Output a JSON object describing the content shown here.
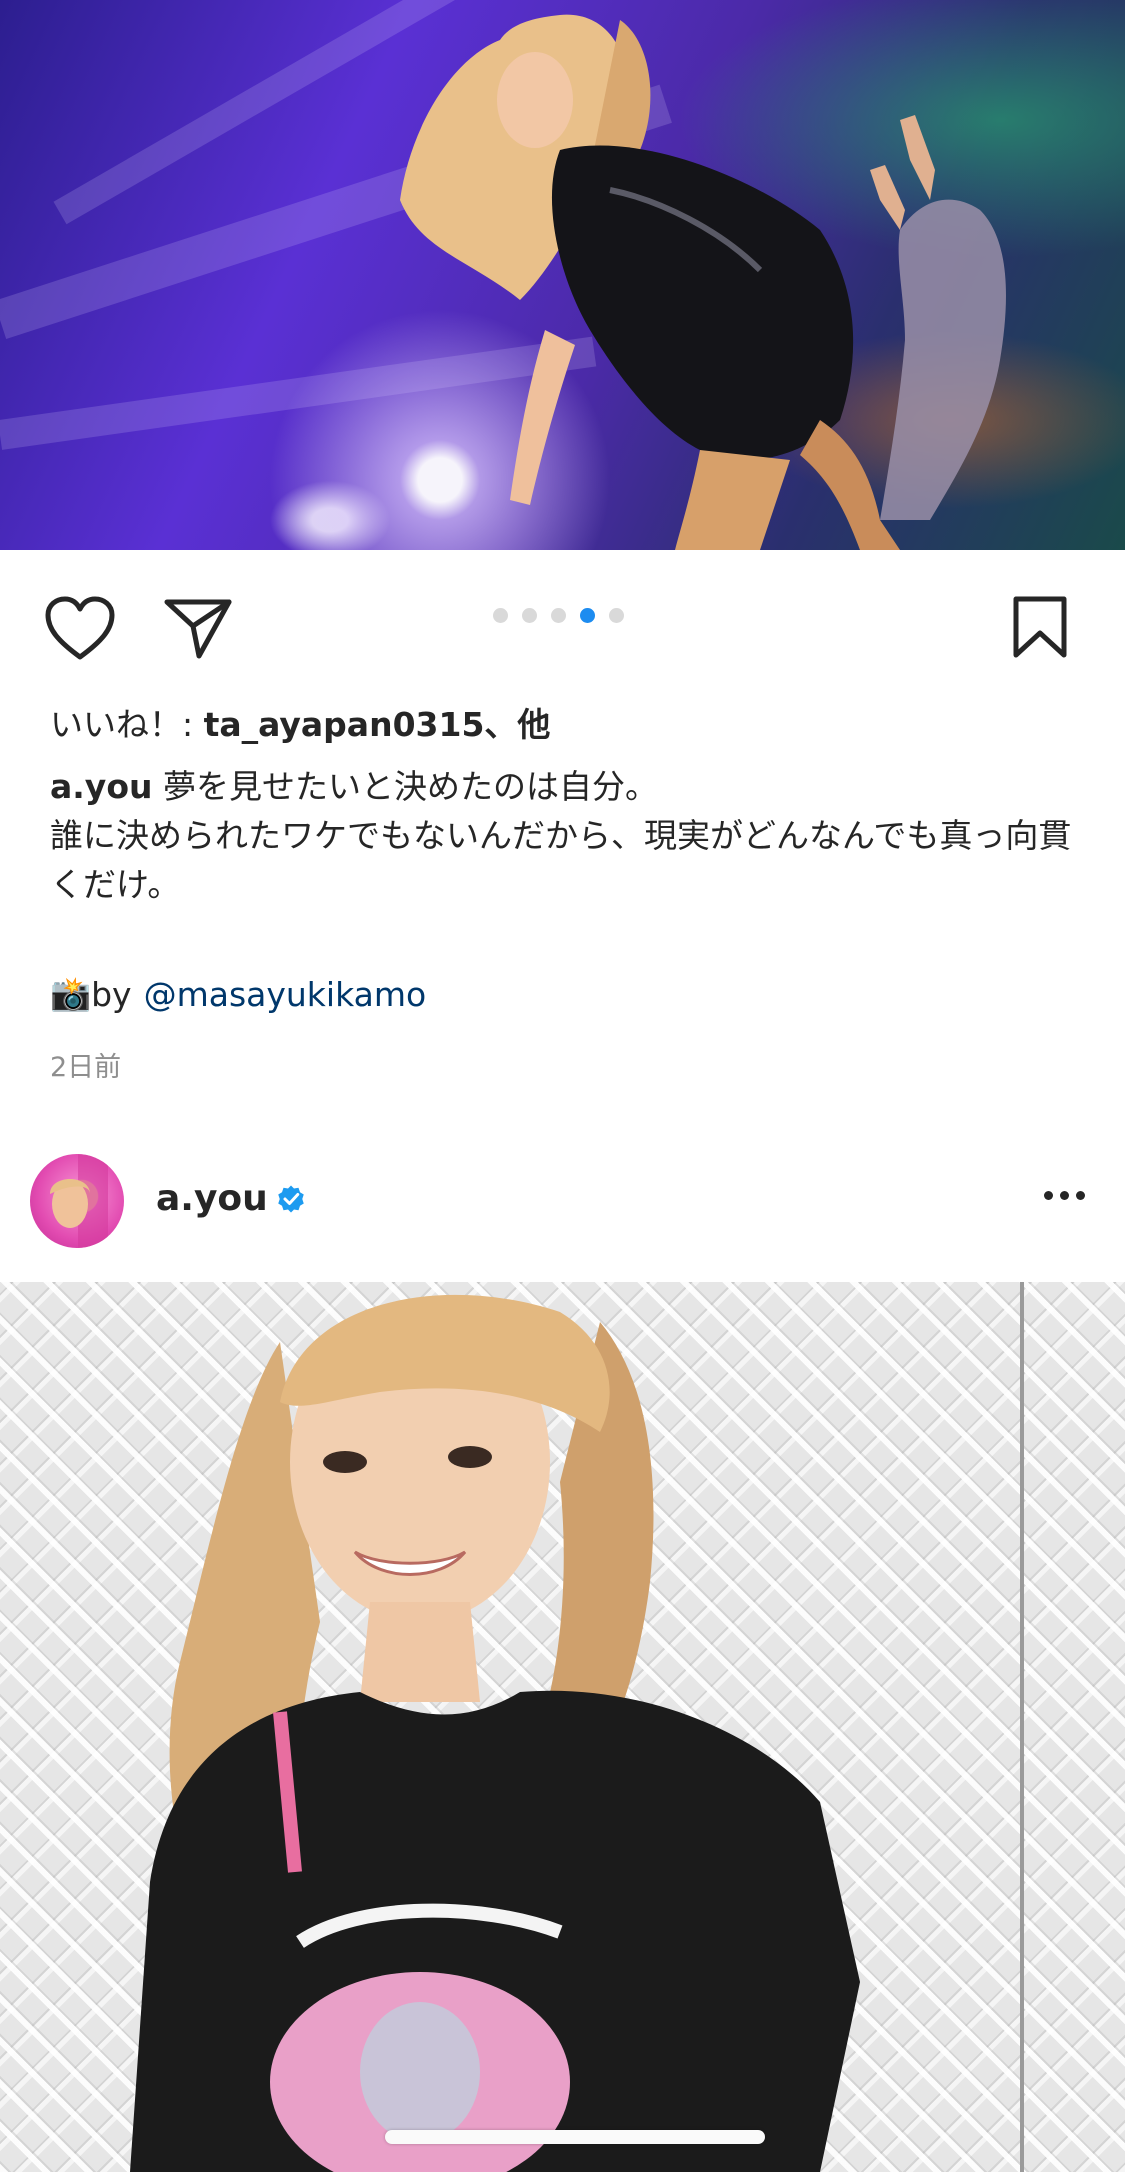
{
  "post1": {
    "photo_alt": "concert-performer-photo",
    "carousel": {
      "count": 5,
      "active_index": 3
    },
    "likes_prefix": "いいね！: ",
    "likes_user": "ta_ayapan0315",
    "likes_suffix": "、他",
    "caption_user": "a.you",
    "caption_line1": "夢を見せたいと決めたのは自分。",
    "caption_line2": "誰に決められたワケでもないんだから、現実がどんなんでも真っ向貫くだけ。",
    "credit_emoji": "📸",
    "credit_by": "by",
    "credit_mention": "@masayukikamo",
    "timestamp": "2日前"
  },
  "post2": {
    "username": "a.you",
    "verified": true,
    "photo_alt": "portrait-photo-against-metal-wall"
  },
  "icons": {
    "like": "heart-icon",
    "share": "paper-plane-icon",
    "save": "bookmark-icon",
    "more": "more-dots-icon",
    "verified": "verified-badge-icon"
  },
  "colors": {
    "active_dot": "#1d8cf0",
    "mention": "#00376b",
    "verified": "#1d9bf0"
  }
}
